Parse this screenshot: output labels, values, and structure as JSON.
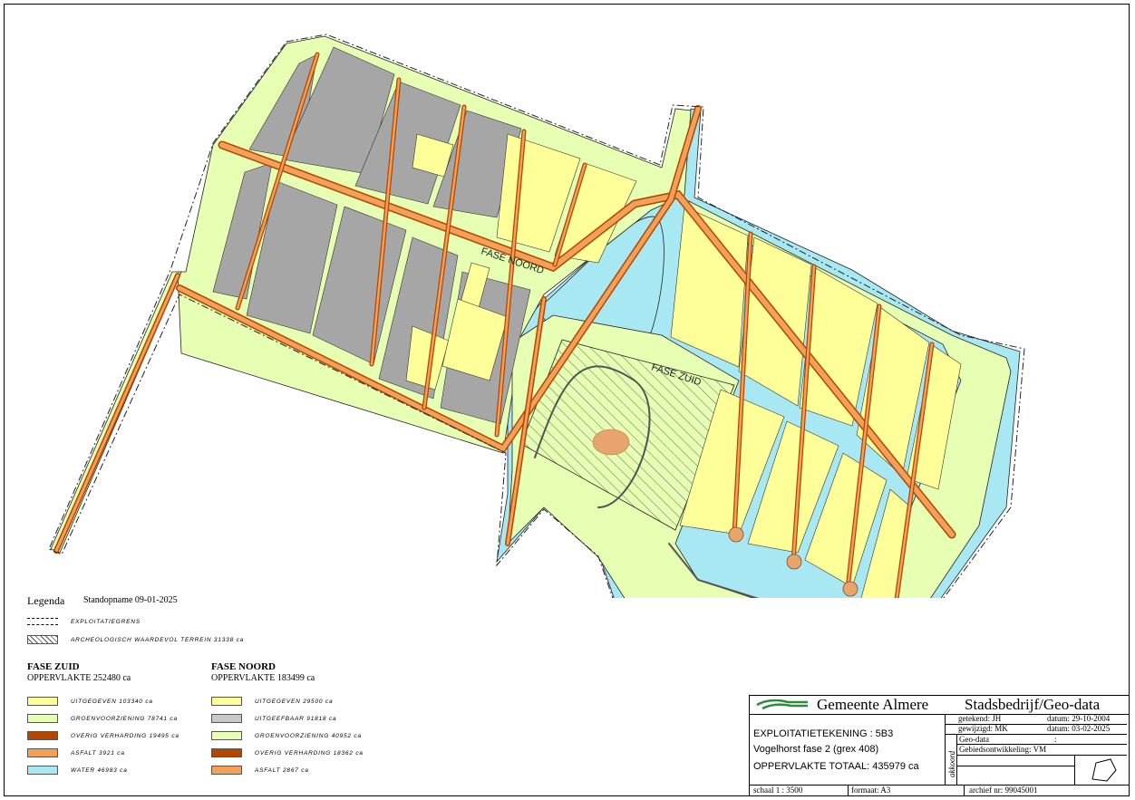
{
  "map": {
    "labels": {
      "noord": "FASE NOORD",
      "zuid": "FASE ZUID"
    },
    "colors": {
      "uitgegeven": "#ffff99",
      "groenvoorziening": "#e6ffb3",
      "overig_verharding": "#b34700",
      "asfalt": "#f2a05a",
      "water": "#a8e8f2",
      "uitgeefbaar": "#a6a6a6"
    }
  },
  "legend": {
    "title": "Legenda",
    "date": "Standopname 09-01-2025",
    "boundary": "EXPLOITATIEGRENS",
    "archeo": "ARCHEOLOGISCH WAARDEVOL TERREIN 31338 ca",
    "zuid": {
      "name": "FASE ZUID",
      "area": "OPPERVLAKTE  252480 ca",
      "items": [
        {
          "label": "UITGEGEVEN 103340 ca",
          "color": "#ffff99"
        },
        {
          "label": "GROENVOORZIENING 78741 ca",
          "color": "#e6ffb3"
        },
        {
          "label": "OVERIG VERHARDING 19495 ca",
          "color": "#b34700"
        },
        {
          "label": "ASFALT 3921 ca",
          "color": "#f2a05a"
        },
        {
          "label": "WATER 46983 ca",
          "color": "#a8e8f2"
        }
      ]
    },
    "noord": {
      "name": "FASE NOORD",
      "area": "OPPERVLAKTE  183499 ca",
      "items": [
        {
          "label": "UITGEGEVEN 29500 ca",
          "color": "#ffff99"
        },
        {
          "label": "UITGEEFBAAR 91818 ca",
          "color": "#c8c8c8"
        },
        {
          "label": "GROENVOORZIENING 40952 ca",
          "color": "#e6ffb3"
        },
        {
          "label": "OVERIG VERHARDING 18362 ca",
          "color": "#b34700"
        },
        {
          "label": "ASFALT 2867 ca",
          "color": "#f2a05a"
        }
      ]
    }
  },
  "titleblock": {
    "org": "Gemeente Almere",
    "dept": "Stadsbedrijf/Geo-data",
    "drawing": "EXPLOITATIETEKENING : 5B3",
    "project": "Vogelhorst fase 2  (grex 408)",
    "total": "OPPERVLAKTE TOTAAL:   435979 ca",
    "getekend": "getekend: JH",
    "datum1": "datum:  29-10-2004",
    "gewijzigd": "gewijzigd:  MK",
    "datum2": "datum:  03-02-2025",
    "akkoord": "akkoord",
    "geodata": "Geo-data",
    "colon": ":",
    "gebied": "Gebiedsontwikkeling: VM",
    "schaal": "schaal    1 : 3500",
    "formaat": "formaat:  A3",
    "archief": "archief nr: 99045001"
  }
}
